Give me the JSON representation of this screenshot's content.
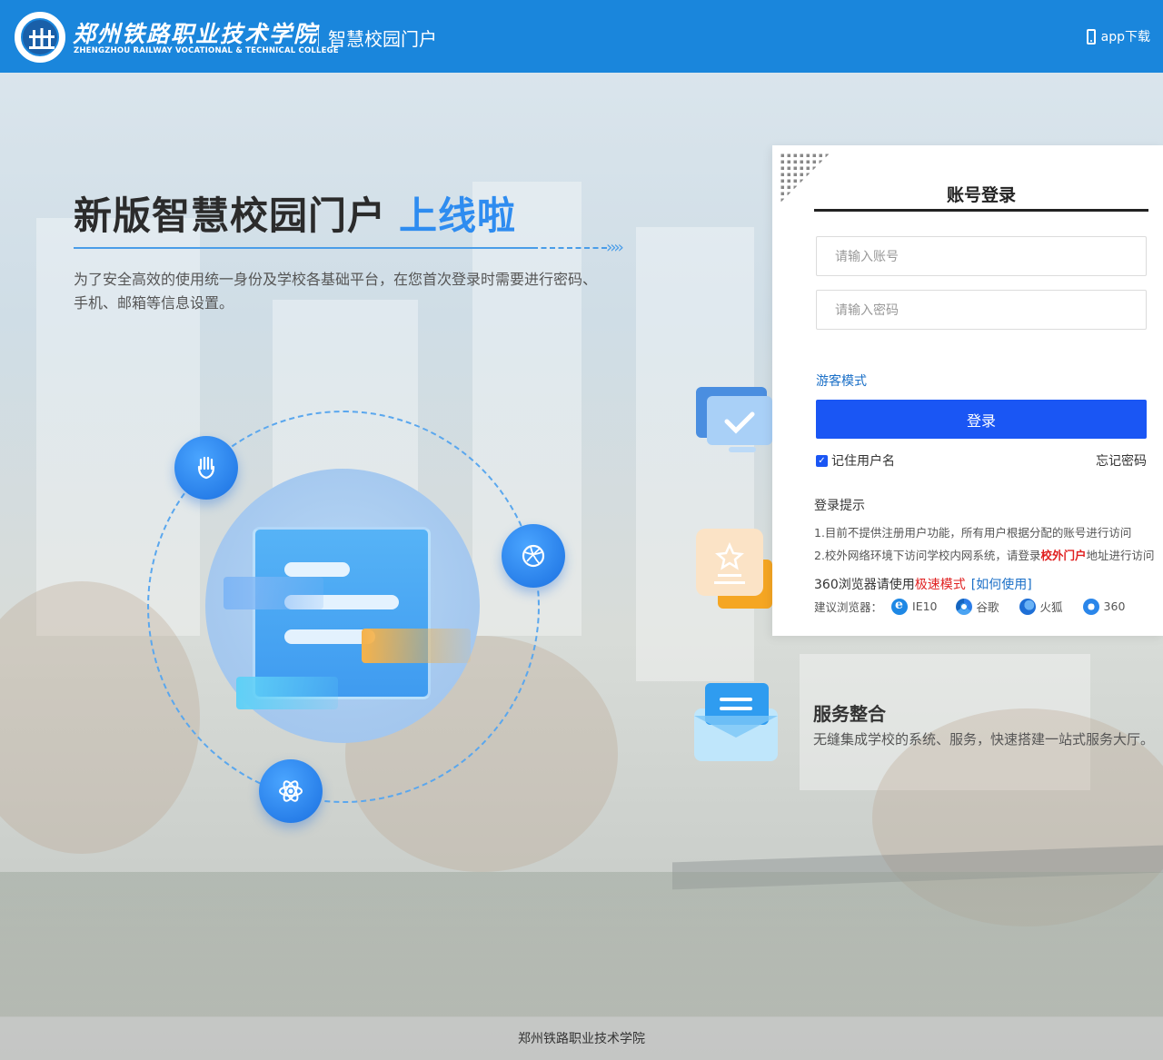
{
  "header": {
    "school_name_cn": "郑州铁路职业技术学院",
    "school_name_en": "ZHENGZHOU RAILWAY VOCATIONAL & TECHNICAL COLLEGE",
    "portal_title": "智慧校园门户",
    "app_download": "app下载",
    "bg_color": "#1a86dc"
  },
  "hero": {
    "title_main": "新版智慧校园门户",
    "title_accent": "上线啦",
    "arrows": "››››",
    "description": "为了安全高效的使用统一身份及学校各基础平台，在您首次登录时需要进行密码、手机、邮箱等信息设置。"
  },
  "features": {
    "service_title": "服务整合",
    "service_desc": "无缝集成学校的系统、服务，快速搭建一站式服务大厅。"
  },
  "login": {
    "title": "账号登录",
    "account_placeholder": "请输入账号",
    "password_placeholder": "请输入密码",
    "guest_mode": "游客模式",
    "submit": "登录",
    "remember": "记住用户名",
    "forgot": "忘记密码",
    "tips_title": "登录提示",
    "tip1": "1.目前不提供注册用户功能，所有用户根据分配的账号进行访问",
    "tip2_prefix": "2.校外网络环境下访问学校内网系统，请登录",
    "tip2_link": "校外门户",
    "tip2_suffix": "地址进行访问",
    "browser_hint_prefix": "360浏览器请使用",
    "browser_hint_mode": "极速模式",
    "browser_hint_link": "[如何使用]",
    "recommend_label": "建议浏览器：",
    "browsers": [
      "IE10",
      "谷歌",
      "火狐",
      "360"
    ],
    "accent_color": "#1a56f4"
  },
  "footer": {
    "text": "郑州铁路职业技术学院"
  }
}
